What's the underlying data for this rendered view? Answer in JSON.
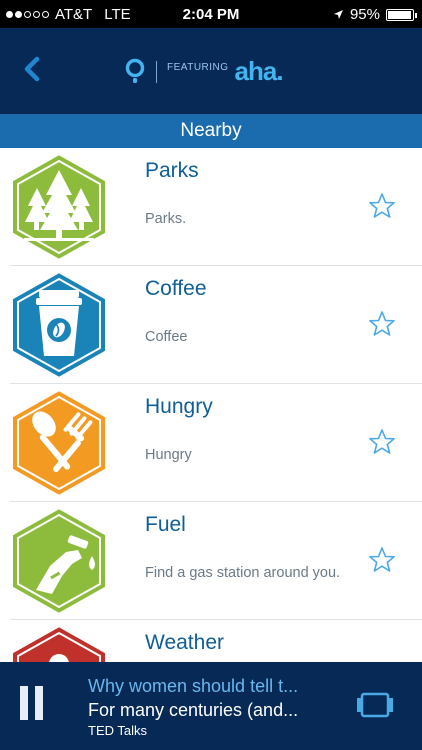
{
  "status_bar": {
    "carrier": "AT&T",
    "network": "LTE",
    "time": "2:04 PM",
    "battery_text": "95%",
    "battery_level": 0.95,
    "signal_bars": 2,
    "signal_total": 5,
    "icons": [
      "location-arrow-icon",
      "battery-icon"
    ]
  },
  "header": {
    "back_icon": "chevron-left-icon",
    "logo_icon": "location-pin-icon",
    "featuring_label": "FEATURING",
    "brand_name": "aha."
  },
  "section": {
    "title": "Nearby"
  },
  "items": [
    {
      "title": "Parks",
      "description": "Parks.",
      "icon": "trees-icon",
      "color": "#8dbc3c"
    },
    {
      "title": "Coffee",
      "description": "Coffee",
      "icon": "coffee-cup-icon",
      "color": "#1a83b8"
    },
    {
      "title": "Hungry",
      "description": "Hungry",
      "icon": "spoon-fork-icon",
      "color": "#f29a22"
    },
    {
      "title": "Fuel",
      "description": "Find a gas station around you.",
      "icon": "fuel-nozzle-icon",
      "color": "#8dbc3c"
    },
    {
      "title": "Weather",
      "description": "",
      "icon": "weather-icon",
      "color": "#c0312b"
    }
  ],
  "player": {
    "title": "Why women should tell t...",
    "description": "For many centuries (and...",
    "source": "TED Talks",
    "pause_icon": "pause-icon",
    "screen_icon": "screen-icon"
  },
  "colors": {
    "header_bg": "#062a55",
    "section_bg": "#1b6cae",
    "title_text": "#0f5e96",
    "accent": "#43b4f0"
  }
}
